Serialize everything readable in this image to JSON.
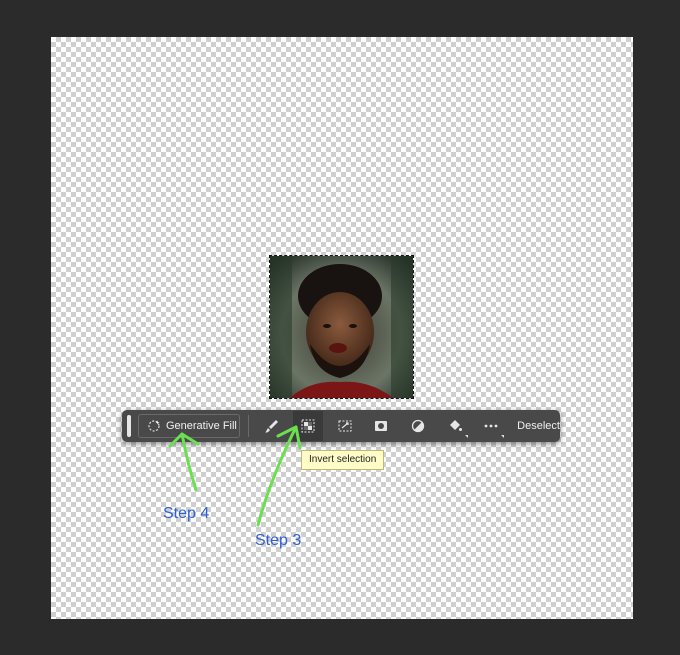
{
  "toolbar": {
    "generative_fill_label": "Generative Fill",
    "deselect_label": "Deselect",
    "tools": [
      {
        "name": "brush-icon"
      },
      {
        "name": "invert-selection-icon",
        "active": true
      },
      {
        "name": "transform-selection-icon"
      },
      {
        "name": "mask-icon"
      },
      {
        "name": "adjustment-icon"
      },
      {
        "name": "fill-bucket-icon"
      },
      {
        "name": "more-options-icon"
      }
    ]
  },
  "tooltip": {
    "text": "Invert selection"
  },
  "annotations": {
    "step4": "Step 4",
    "step3": "Step 3",
    "arrow_color": "#6be04f",
    "text_color": "#2f5fd6"
  },
  "colors": {
    "workspace_bg": "#2b2b2b",
    "toolbar_bg": "#494949",
    "tooltip_bg": "#fffcc8"
  }
}
